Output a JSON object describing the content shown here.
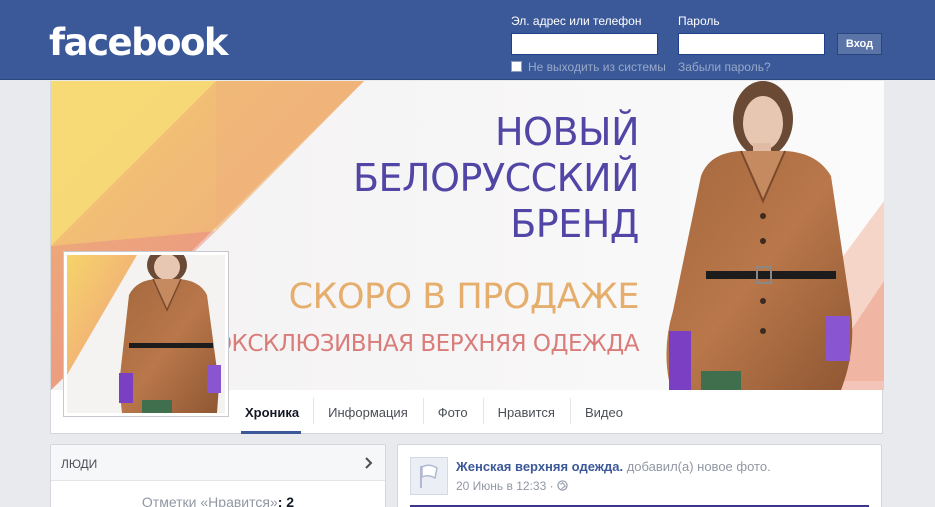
{
  "header": {
    "logo": "facebook",
    "email_label": "Эл. адрес или телефон",
    "email_value": "",
    "password_label": "Пароль",
    "password_value": "",
    "login_button": "Вход",
    "keep_logged_in": "Не выходить из системы",
    "forgot_password": "Забыли пароль?"
  },
  "cover": {
    "headline": [
      "НОВЫЙ",
      "БЕЛОРУССКИЙ",
      "БРЕНД"
    ],
    "soon": "СКОРО В ПРОДАЖЕ",
    "exclusive": "ЭКСКЛЮЗИВНАЯ ВЕРХНЯЯ ОДЕЖДА"
  },
  "tabs": [
    {
      "label": "Хроника",
      "active": true
    },
    {
      "label": "Информация",
      "active": false
    },
    {
      "label": "Фото",
      "active": false
    },
    {
      "label": "Нравится",
      "active": false
    },
    {
      "label": "Видео",
      "active": false
    }
  ],
  "people": {
    "title": "ЛЮДИ",
    "likes_label": "Отметки «Нравится»",
    "likes_separator": ":",
    "likes_count": "2"
  },
  "post": {
    "author": "Женская верхняя одежда.",
    "action": "добавил(а) новое фото.",
    "date": "20 Июнь в 12:33",
    "separator": "·"
  },
  "colors": {
    "brand_blue": "#3b5998",
    "headline_purple": "#5145a6",
    "soon_gold": "#e6ae6c",
    "exclusive_pink": "#d97c7a"
  },
  "icons": {
    "people_chevron": "chevron-right-icon",
    "privacy": "globe-icon",
    "post_avatar": "flag-icon"
  }
}
